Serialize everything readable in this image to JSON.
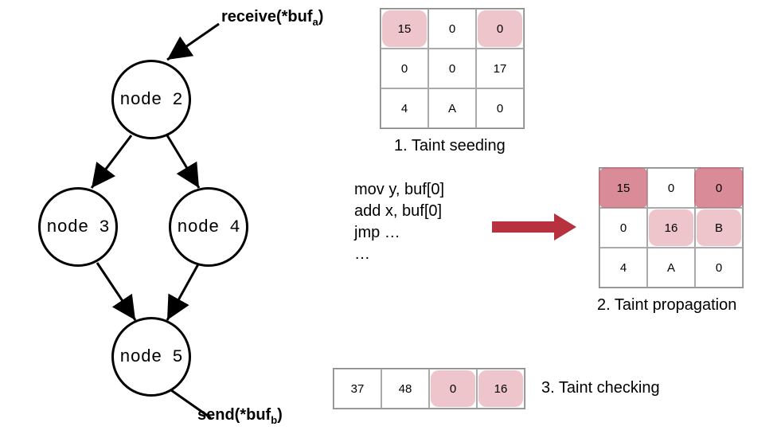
{
  "labels": {
    "receive_full": "receive(*buf",
    "receive_sub": "a",
    "receive_close": ")",
    "send_full": "send(*buf",
    "send_sub": "b",
    "send_close": ")"
  },
  "nodes": {
    "n2": "node 2",
    "n3": "node 3",
    "n4": "node 4",
    "n5": "node 5"
  },
  "grid_seed": [
    "15",
    "0",
    "0",
    "0",
    "0",
    "17",
    "4",
    "A",
    "0"
  ],
  "grid_prop": [
    "15",
    "0",
    "0",
    "0",
    "16",
    "B",
    "4",
    "A",
    "0"
  ],
  "grid_check": [
    "37",
    "48",
    "0",
    "16"
  ],
  "captions": {
    "seed": "1. Taint seeding",
    "prop": "2. Taint propagation",
    "check": "3. Taint checking"
  },
  "code": {
    "l1": "mov y, buf[0]",
    "l2": "add x, buf[0]",
    "l3": "jmp …",
    "l4": "…"
  }
}
